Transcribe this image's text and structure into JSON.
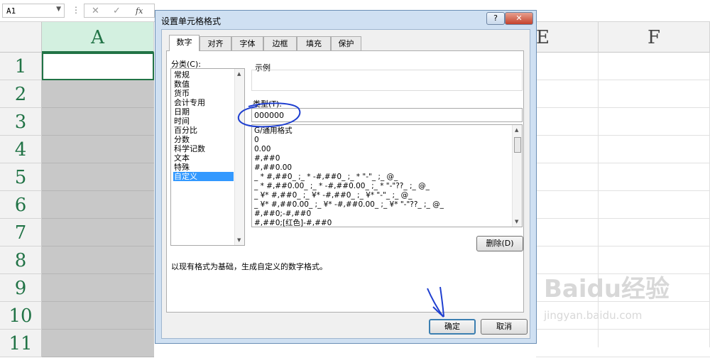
{
  "formula_bar": {
    "name_box": "A1",
    "dots": "⋮",
    "cancel": "✕",
    "enter": "✓",
    "fx": "fx"
  },
  "columns": {
    "a": "A",
    "e": "E",
    "f": "F"
  },
  "rows": [
    "1",
    "2",
    "3",
    "4",
    "5",
    "6",
    "7",
    "8",
    "9",
    "10",
    "11"
  ],
  "dialog": {
    "title": "设置单元格格式",
    "help": "?",
    "close": "✕",
    "tabs": [
      "数字",
      "对齐",
      "字体",
      "边框",
      "填充",
      "保护"
    ],
    "category_label": "分类(C):",
    "categories": [
      "常规",
      "数值",
      "货币",
      "会计专用",
      "日期",
      "时间",
      "百分比",
      "分数",
      "科学记数",
      "文本",
      "特殊",
      "自定义"
    ],
    "selected_category": "自定义",
    "sample_label": "示例",
    "type_label": "类型(T):",
    "type_value": "000000",
    "formats": [
      "G/通用格式",
      "0",
      "0.00",
      "#,##0",
      "#,##0.00",
      "_ * #,##0_ ;_ * -#,##0_ ;_ * \"-\"_ ;_ @_",
      "_ * #,##0.00_ ;_ * -#,##0.00_ ;_ * \"-\"??_ ;_ @_",
      "_ ¥* #,##0_ ;_ ¥* -#,##0_ ;_ ¥* \"-\"_ ;_ @_",
      "_ ¥* #,##0.00_ ;_ ¥* -#,##0.00_ ;_ ¥* \"-\"??_ ;_ @_",
      "#,##0;-#,##0",
      "#,##0;[红色]-#,##0"
    ],
    "delete_button": "删除(D)",
    "description": "以现有格式为基础，生成自定义的数字格式。",
    "ok_button": "确定",
    "cancel_button": "取消"
  },
  "watermark": {
    "brand": "Baidu经验",
    "url": "jingyan.baidu.com"
  },
  "colors": {
    "excel_green": "#217346",
    "ink_blue": "#1f3fd0",
    "selection_blue": "#3399ff"
  }
}
